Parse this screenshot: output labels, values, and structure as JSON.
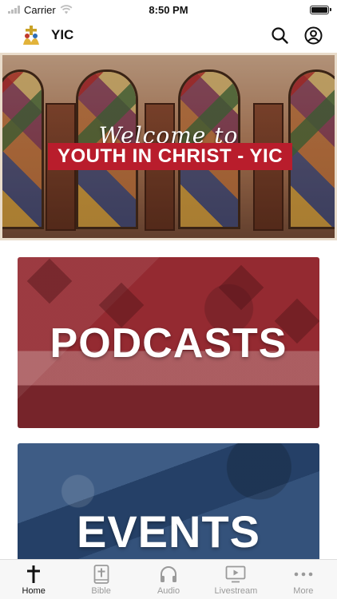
{
  "status_bar": {
    "carrier": "Carrier",
    "time": "8:50 PM"
  },
  "header": {
    "title": "YIC"
  },
  "hero": {
    "welcome_text": "Welcome to",
    "banner_text": "YOUTH IN CHRIST - YIC"
  },
  "cards": [
    {
      "label": "PODCASTS"
    },
    {
      "label": "EVENTS"
    }
  ],
  "tabs": [
    {
      "label": "Home",
      "icon": "cross-icon",
      "active": true
    },
    {
      "label": "Bible",
      "icon": "bible-icon",
      "active": false
    },
    {
      "label": "Audio",
      "icon": "headphones-icon",
      "active": false
    },
    {
      "label": "Livestream",
      "icon": "tv-play-icon",
      "active": false
    },
    {
      "label": "More",
      "icon": "more-dots-icon",
      "active": false
    }
  ],
  "colors": {
    "podcasts_card": "#9c2f35",
    "events_card": "#2c4a74",
    "banner_red": "#b91d2c",
    "tab_active": "#111111",
    "tab_inactive": "#9a9a9a"
  }
}
